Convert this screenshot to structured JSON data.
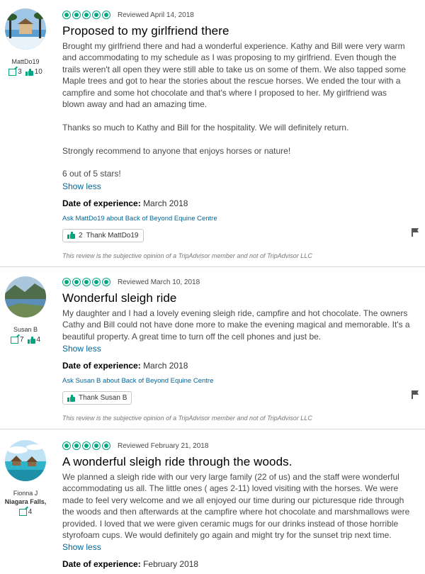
{
  "reviews": [
    {
      "username": "MattDo19",
      "location": "",
      "review_count": "3",
      "helpful_count": "10",
      "rating": 5,
      "reviewed_date": "Reviewed April 14, 2018",
      "title": "Proposed to my girlfriend there",
      "paragraphs": [
        "Brought my girlfriend there and had a wonderful experience. Kathy and Bill were very warm and accommodating to my schedule as I was proposing to my girlfriend. Even though the trails weren't all open they were still able to take us on some of them. We also tapped some Maple trees and got to hear the stories about the rescue horses. We ended the tour with a campfire and some hot chocolate and that's where I proposed to her. My girlfriend was blown away and had an amazing time.",
        "Thanks so much to Kathy and Bill for the hospitality. We will definitely return.",
        "Strongly recommend to anyone that enjoys horses or nature!",
        "6 out of 5 stars!"
      ],
      "show_less": "Show less",
      "doe_label": "Date of experience:",
      "doe_value": "March 2018",
      "ask": "Ask MattDo19 about Back of Beyond Equine Centre",
      "thank_count": "2",
      "thank_label": "Thank MattDo19",
      "disclaimer": "This review is the subjective opinion of a TripAdvisor member and not of TripAdvisor LLC"
    },
    {
      "username": "Susan B",
      "location": "",
      "review_count": "7",
      "helpful_count": "4",
      "rating": 5,
      "reviewed_date": "Reviewed March 10, 2018",
      "title": "Wonderful sleigh ride",
      "paragraphs": [
        "My daughter and I had a lovely evening sleigh ride, campfire and hot chocolate. The owners Cathy and Bill could not have done more to make the evening magical and memorable. It's a beautiful property. A great time to turn off the cell phones and just be."
      ],
      "show_less": "Show less",
      "doe_label": "Date of experience:",
      "doe_value": "March 2018",
      "ask": "Ask Susan B about Back of Beyond Equine Centre",
      "thank_count": "",
      "thank_label": "Thank Susan B",
      "disclaimer": "This review is the subjective opinion of a TripAdvisor member and not of TripAdvisor LLC"
    },
    {
      "username": "Fionna J",
      "location": "Niagara Falls,",
      "review_count": "4",
      "helpful_count": "",
      "rating": 5,
      "reviewed_date": "Reviewed February 21, 2018",
      "title": "A wonderful sleigh ride through the woods.",
      "paragraphs": [
        "We planned a sleigh ride with our very large family (22 of us) and the staff were wonderful accommodating us all. The little ones ( ages 2-11) loved visiting with the horses. We were made to feel very welcome and we all enjoyed our time during our picturesque ride through the woods and then afterwards at the campfire where hot chocolate and marshmallows were provided. I loved that we were given ceramic mugs for our drinks instead of those horrible styrofoam cups. We would definitely go again and might try for the sunset trip next time."
      ],
      "show_less": "Show less",
      "doe_label": "Date of experience:",
      "doe_value": "February 2018"
    }
  ],
  "colors": {
    "accent": "#00a680",
    "link": "#006699"
  }
}
